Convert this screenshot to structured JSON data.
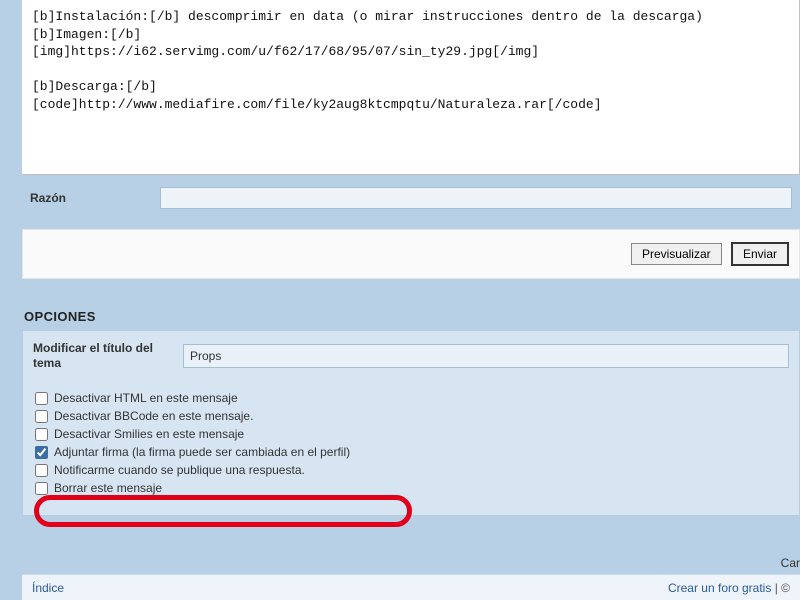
{
  "message_text": "[b]Instalación:[/b] descomprimir en data (o mirar instrucciones dentro de la descarga)\n[b]Imagen:[/b]\n[img]https://i62.servimg.com/u/f62/17/68/95/07/sin_ty29.jpg[/img]\n\n[b]Descarga:[/b]\n[code]http://www.mediafire.com/file/ky2aug8ktcmpqtu/Naturaleza.rar[/code]",
  "razon": {
    "label": "Razón",
    "value": ""
  },
  "buttons": {
    "preview": "Previsualizar",
    "submit": "Enviar"
  },
  "opciones": {
    "heading": "OPCIONES",
    "modify_label": "Modificar el título del tema",
    "modify_value": "Props",
    "checks": [
      {
        "label": "Desactivar HTML en este mensaje",
        "checked": false
      },
      {
        "label": "Desactivar BBCode en este mensaje.",
        "checked": false
      },
      {
        "label": "Desactivar Smilies en este mensaje",
        "checked": false
      },
      {
        "label": "Adjuntar firma (la firma puede ser cambiada en el perfil)",
        "checked": true
      },
      {
        "label": "Notificarme cuando se publique una respuesta.",
        "checked": false
      },
      {
        "label": "Borrar este mensaje",
        "checked": false
      }
    ]
  },
  "cut_right": "Car",
  "footer": {
    "indice": "Índice",
    "crear": "Crear un foro gratis",
    "sep": " | ©"
  }
}
